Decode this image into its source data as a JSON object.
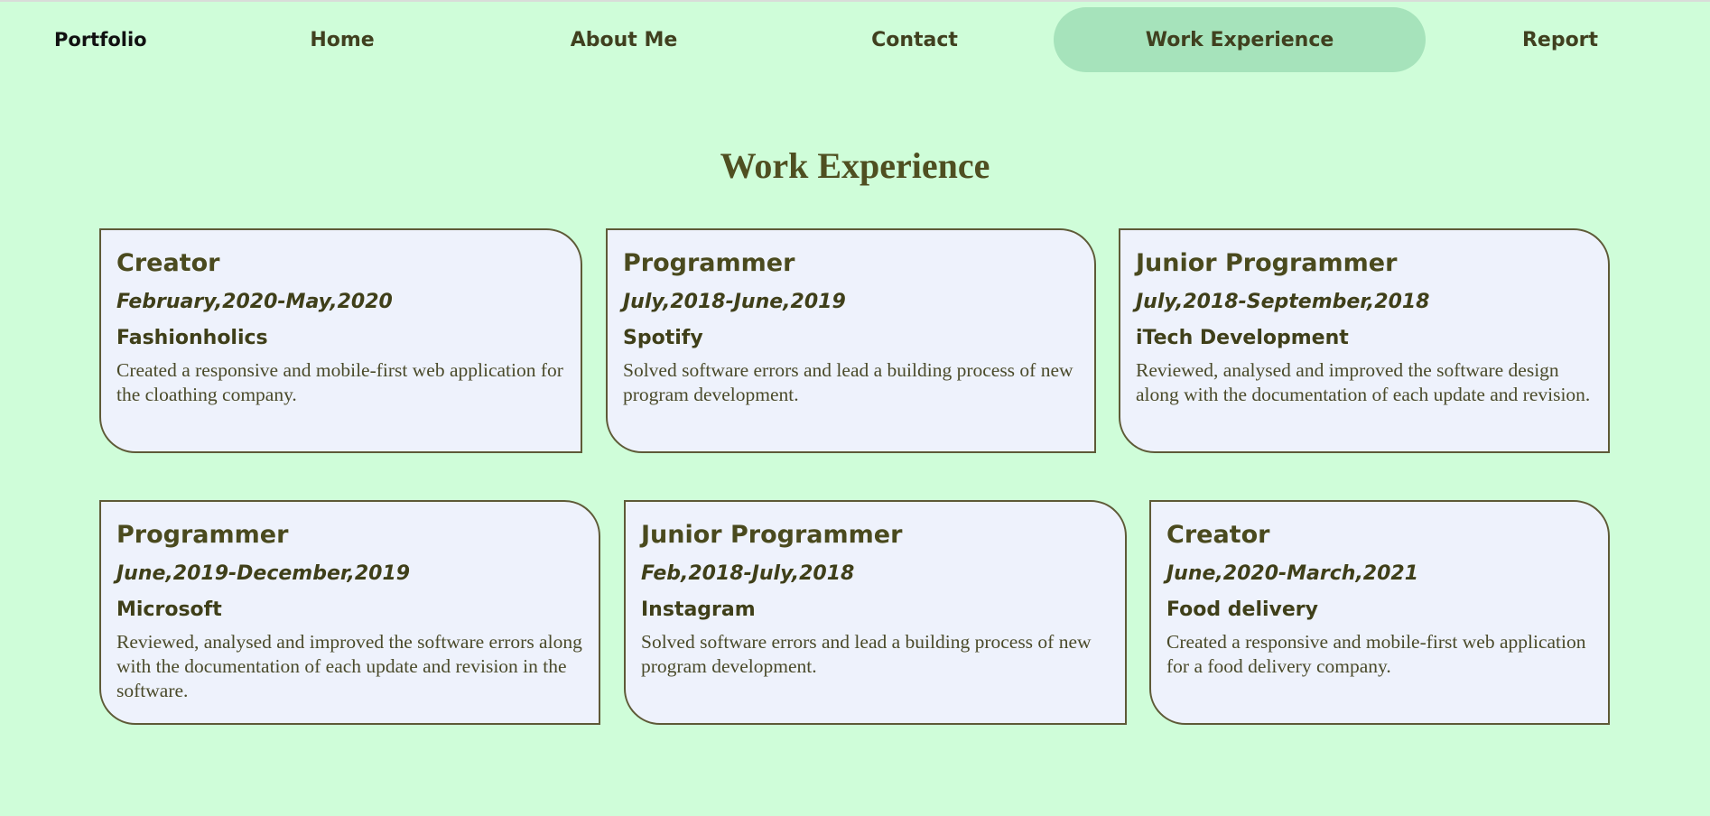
{
  "nav": {
    "brand": "Portfolio",
    "items": [
      {
        "label": "Home"
      },
      {
        "label": "About Me"
      },
      {
        "label": "Contact"
      },
      {
        "label": "Work Experience",
        "active": true
      },
      {
        "label": "Report"
      }
    ]
  },
  "main": {
    "title": "Work Experience",
    "cards": [
      {
        "role": "Creator",
        "dates": "February,2020-May,2020",
        "company": "Fashionholics",
        "description": "Created a responsive and mobile-first web application for the cloathing company."
      },
      {
        "role": "Programmer",
        "dates": "July,2018-June,2019",
        "company": "Spotify",
        "description": "Solved software errors and lead a building process of new program development."
      },
      {
        "role": "Junior Programmer",
        "dates": "July,2018-September,2018",
        "company": "iTech Development",
        "description": "Reviewed, analysed and improved the software design along with the documentation of each update and revision."
      },
      {
        "role": "Programmer",
        "dates": "June,2019-December,2019",
        "company": "Microsoft",
        "description": "Reviewed, analysed and improved the software errors along with the documentation of each update and revision in the software."
      },
      {
        "role": "Junior Programmer",
        "dates": "Feb,2018-July,2018",
        "company": "Instagram",
        "description": "Solved software errors and lead a building process of new program development."
      },
      {
        "role": "Creator",
        "dates": "June,2020-March,2021",
        "company": "Food delivery",
        "description": "Created a responsive and mobile-first web application for a food delivery company."
      }
    ]
  },
  "colors": {
    "background": "#cffdd9",
    "nav_active": "#a6e3bb",
    "card_background": "#eef2fc",
    "card_border": "#5e5a37",
    "text_primary": "#4a4a1e"
  }
}
